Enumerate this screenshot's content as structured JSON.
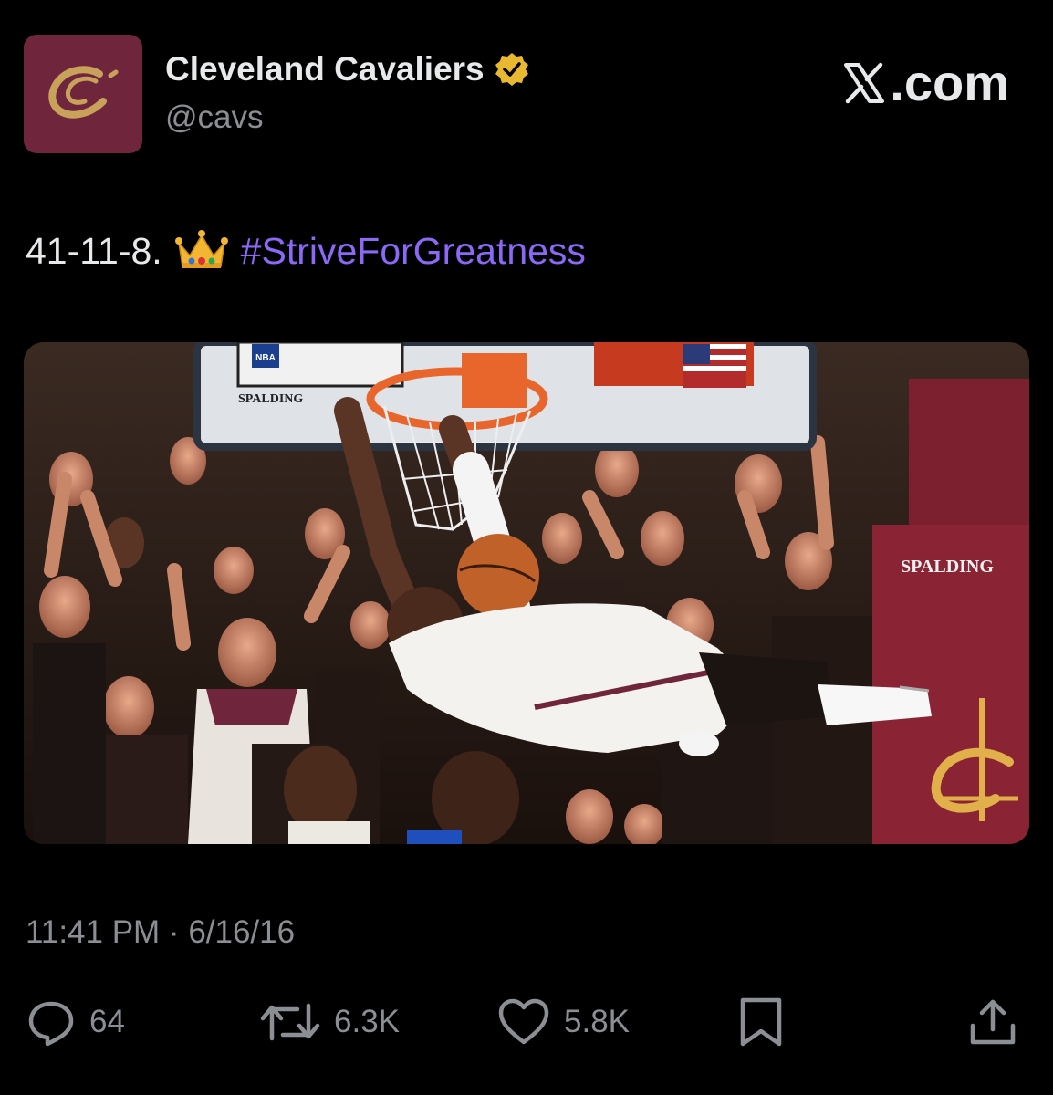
{
  "author": {
    "display_name": "Cleveland Cavaliers",
    "handle": "@cavs",
    "verified": true,
    "avatar_icon": "cavs-c-logo-icon",
    "avatar_color": "#6f263d",
    "avatar_logo_color": "#c8a15a"
  },
  "site": {
    "brand_suffix": ".com",
    "brand_icon": "x-logo-icon"
  },
  "tweet": {
    "text_prefix": "41-11-8.",
    "emoji_icon": "crown-icon",
    "hashtag": "#StriveForGreatness",
    "hashtag_color": "#8b68f6"
  },
  "media": {
    "type": "photo",
    "backboard_labels": {
      "brand": "SPALDING",
      "stanchion_brand": "SPALDING",
      "league_logo": "NBA"
    }
  },
  "meta": {
    "timestamp": "11:41 PM · 6/16/16"
  },
  "actions": {
    "reply_count": "64",
    "retweet_count": "6.3K",
    "like_count": "5.8K",
    "icon_color": "#8b8f94"
  }
}
